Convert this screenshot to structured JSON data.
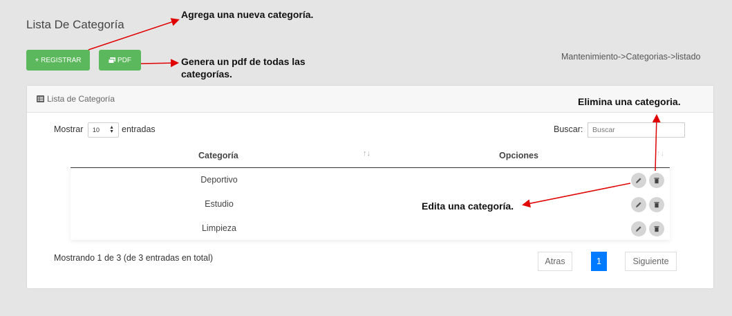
{
  "page": {
    "title": "Lista De Categoría",
    "breadcrumb": "Mantenimiento->Categorias->listado"
  },
  "toolbar": {
    "register_label": "+ REGISTRAR",
    "pdf_label": "PDF"
  },
  "annotations": {
    "add": "Agrega una nueva categoría.",
    "pdf_line1": "Genera un pdf de todas las",
    "pdf_line2": "categorías.",
    "delete": "Elimina una categoria.",
    "edit": "Edita una categoría."
  },
  "card": {
    "header": "Lista de Categoría"
  },
  "table_controls": {
    "show_label": "Mostrar",
    "page_size": "10",
    "entries_label": "entradas",
    "search_label": "Buscar:",
    "search_placeholder": "Buscar"
  },
  "table": {
    "columns": [
      "Categoría",
      "Opciones"
    ],
    "rows": [
      {
        "categoria": "Deportivo"
      },
      {
        "categoria": "Estudio"
      },
      {
        "categoria": "Limpieza"
      }
    ]
  },
  "footer": {
    "info": "Mostrando 1 de 3 (de 3 entradas en total)",
    "prev_label": "Atras",
    "current_page": "1",
    "next_label": "Siguiente"
  },
  "colors": {
    "success": "#5cb85c",
    "primary": "#007bff",
    "annotation_arrow": "#e00000"
  }
}
